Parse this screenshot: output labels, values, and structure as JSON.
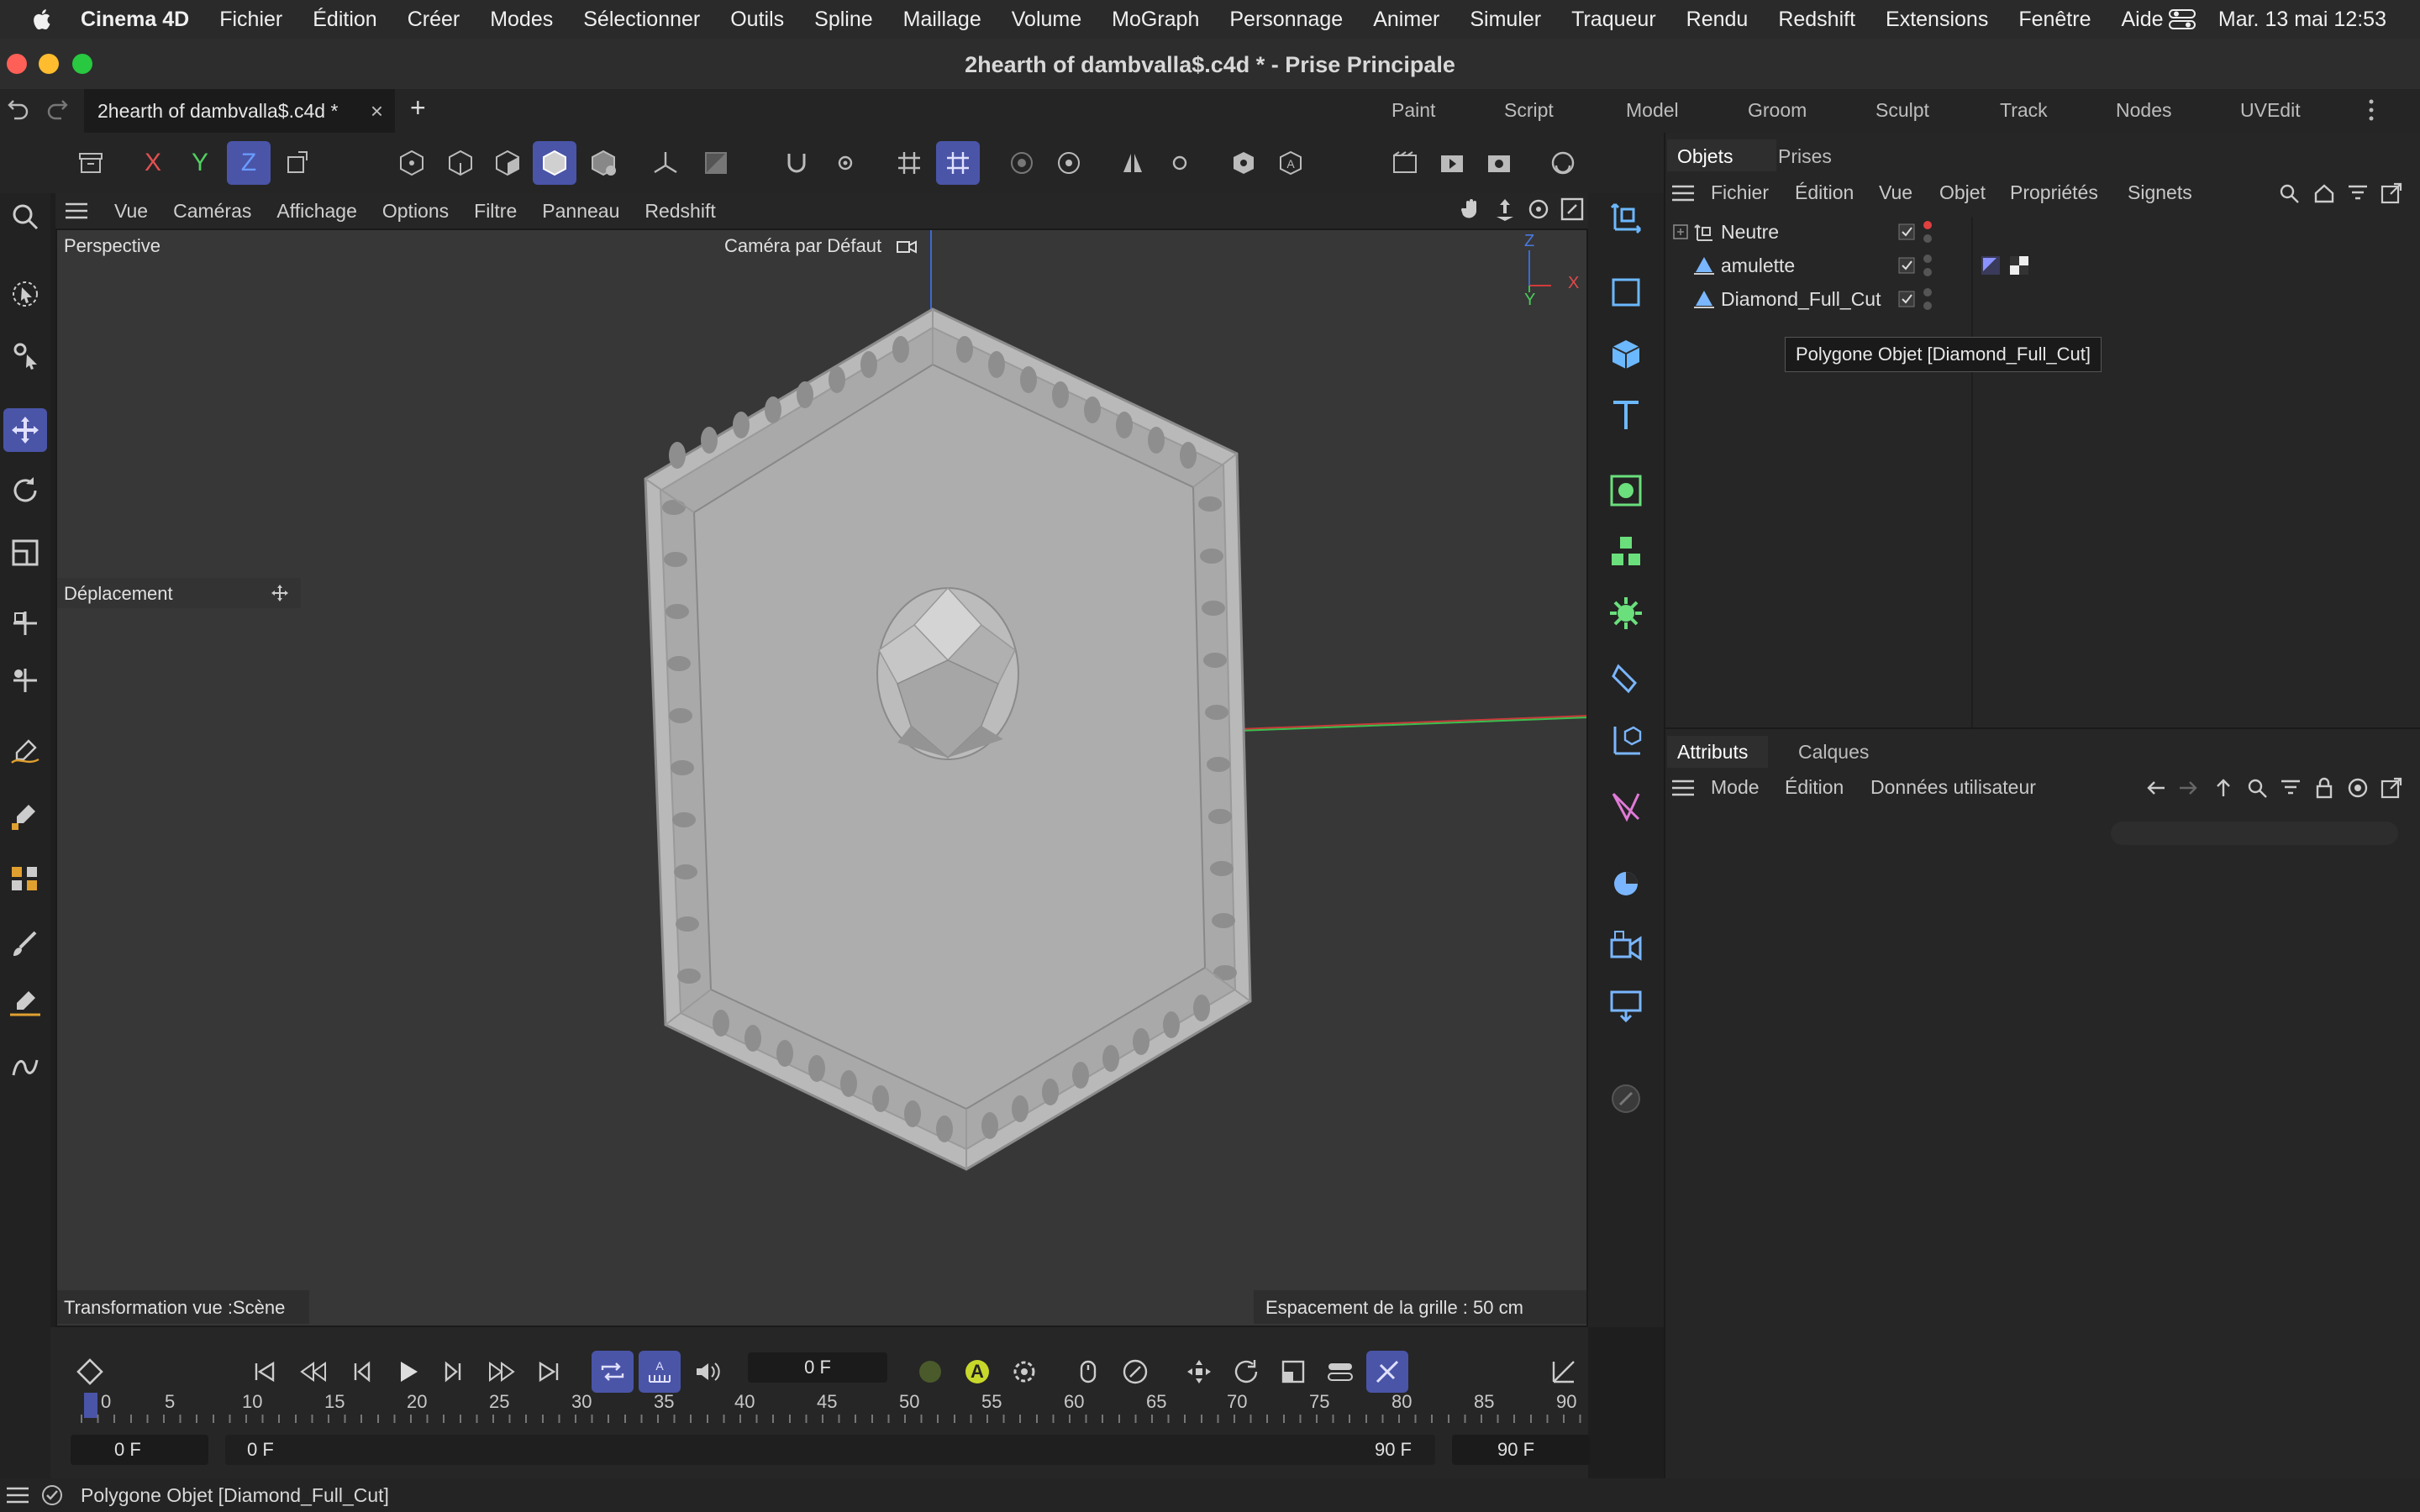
{
  "menubar": {
    "app": "Cinema 4D",
    "items": [
      "Fichier",
      "Édition",
      "Créer",
      "Modes",
      "Sélectionner",
      "Outils",
      "Spline",
      "Maillage",
      "Volume",
      "MoGraph",
      "Personnage",
      "Animer",
      "Simuler",
      "Traqueur",
      "Rendu",
      "Redshift",
      "Extensions",
      "Fenêtre",
      "Aide"
    ],
    "clock": "Mar. 13 mai  12:53"
  },
  "window": {
    "title": "2hearth of dambvalla$.c4d * - Prise Principale"
  },
  "doc_tab": {
    "label": "2hearth of dambvalla$.c4d *",
    "close": "×",
    "add": "+"
  },
  "layouts": [
    "Paint",
    "Script",
    "Model",
    "Groom",
    "Sculpt",
    "Track",
    "Nodes",
    "UVEdit"
  ],
  "toolbar": {
    "x": "X",
    "y": "Y",
    "z": "Z"
  },
  "viewport_menu": [
    "Vue",
    "Caméras",
    "Affichage",
    "Options",
    "Filtre",
    "Panneau",
    "Redshift"
  ],
  "viewport": {
    "view_name": "Perspective",
    "camera": "Caméra par Défaut",
    "tool_name": "Déplacement",
    "transform_info": "Transformation vue :Scène",
    "grid_info": "Espacement de la grille : 50 cm",
    "axis_x": "X",
    "axis_y": "Y",
    "axis_z": "Z"
  },
  "object_manager": {
    "tabs": [
      "Objets",
      "Prises"
    ],
    "menu": [
      "Fichier",
      "Édition",
      "Vue",
      "Objet",
      "Propriétés",
      "Signets"
    ],
    "objects": [
      {
        "name": "Neutre"
      },
      {
        "name": "amulette"
      },
      {
        "name": "Diamond_Full_Cut"
      }
    ],
    "tooltip": "Polygone Objet [Diamond_Full_Cut]"
  },
  "attributes": {
    "tabs": [
      "Attributs",
      "Calques"
    ],
    "menu": [
      "Mode",
      "Édition",
      "Données utilisateur"
    ]
  },
  "timeline": {
    "current_frame": "0 F",
    "ticks": [
      "0",
      "5",
      "10",
      "15",
      "20",
      "25",
      "30",
      "35",
      "40",
      "45",
      "50",
      "55",
      "60",
      "65",
      "70",
      "75",
      "80",
      "85",
      "90"
    ],
    "start_field": "0 F",
    "range_start": "0 F",
    "range_end": "90 F",
    "end_field": "90 F",
    "auto_key": "A"
  },
  "status": {
    "text": "Polygone Objet [Diamond_Full_Cut]"
  },
  "colors": {
    "accent": "#4a55a8",
    "viewport_bg": "#373737",
    "axis_x": "#d23a3a",
    "axis_y": "#3bbf4e",
    "axis_z": "#3a6ad2"
  }
}
